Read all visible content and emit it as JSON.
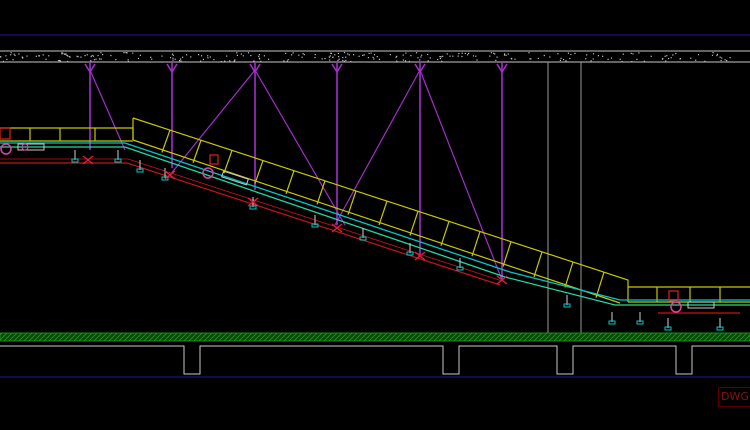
{
  "drawing": {
    "watermark_text": "DWG",
    "colors": {
      "background": "#000000",
      "frame": "#1a1aa8",
      "ceiling": "#c8c8c8",
      "hanger": "#a030c8",
      "truss": "#c8c800",
      "belt": "#00c8c8",
      "belt_line": "#20d8a0",
      "base": "#c81414",
      "column": "#a0a0a0",
      "ground": "#1a8a1a",
      "support": "#d0d0d0"
    }
  }
}
